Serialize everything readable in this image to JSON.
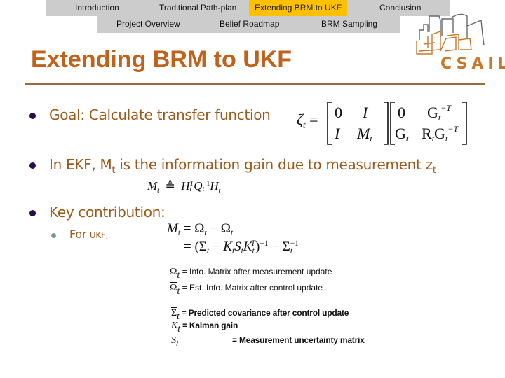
{
  "nav": {
    "row1": [
      {
        "label": "Introduction",
        "active": false
      },
      {
        "label": "Traditional Path-plan",
        "active": false
      },
      {
        "label": "Extending BRM to UKF",
        "active": true
      },
      {
        "label": "Conclusion",
        "active": false
      }
    ],
    "row2": [
      {
        "label": "Project Overview"
      },
      {
        "label": "Belief Roadmap"
      },
      {
        "label": "BRM Sampling"
      }
    ],
    "active_color": "#ffc000",
    "bar_color": "#cccccc"
  },
  "logo": {
    "text": "CSAIL",
    "color": "#c8782a"
  },
  "slide": {
    "title": "Extending BRM to UKF",
    "title_color": "#c0621b",
    "bullets": [
      {
        "text": "Goal: Calculate transfer function"
      },
      {
        "text_pre": "In EKF, M",
        "text_sub1": "t",
        "text_mid": " is the information gain due to measurement z",
        "text_sub2": "t"
      },
      {
        "text": "Key contribution:",
        "sub_bullets": [
          {
            "text_a": "For ",
            "text_b": "UKF,"
          }
        ]
      }
    ],
    "equations": {
      "transfer": {
        "lhs": "ζ",
        "lhs_sub": "t",
        "eq": "=",
        "m1": [
          [
            "0",
            "I"
          ],
          [
            "I",
            "M_t"
          ]
        ],
        "m2": [
          [
            "0",
            "G_t^{-T}"
          ],
          [
            "G_t",
            "R_t G_t^{-T}"
          ]
        ]
      },
      "ekf": {
        "lhs": "M",
        "lhs_sub": "t",
        "op": "≜",
        "rhs": "H_t^T Q_t^{-1} H_t"
      },
      "ukf_line1": "M_t = Ω_t − Ω̄_t",
      "ukf_line2": "= (Σ̄_t − K_t S_t K_t^T)^{-1} − Σ̄_t^{-1}"
    },
    "definitions": [
      {
        "symbol": "Ω",
        "sub": "t",
        "overline": false,
        "text": "= Info. Matrix after measurement update"
      },
      {
        "symbol": "Ω",
        "sub": "t",
        "overline": true,
        "text": "= Est. Info. Matrix after control update"
      },
      {
        "symbol": "Σ",
        "sub": "t",
        "overline": true,
        "text": "= Predicted covariance after control update"
      },
      {
        "symbol": "K",
        "sub": "t",
        "overline": false,
        "text": "= Kalman gain"
      },
      {
        "symbol": "S",
        "sub": "t",
        "overline": false,
        "text": "= Measurement uncertainty matrix"
      }
    ]
  }
}
